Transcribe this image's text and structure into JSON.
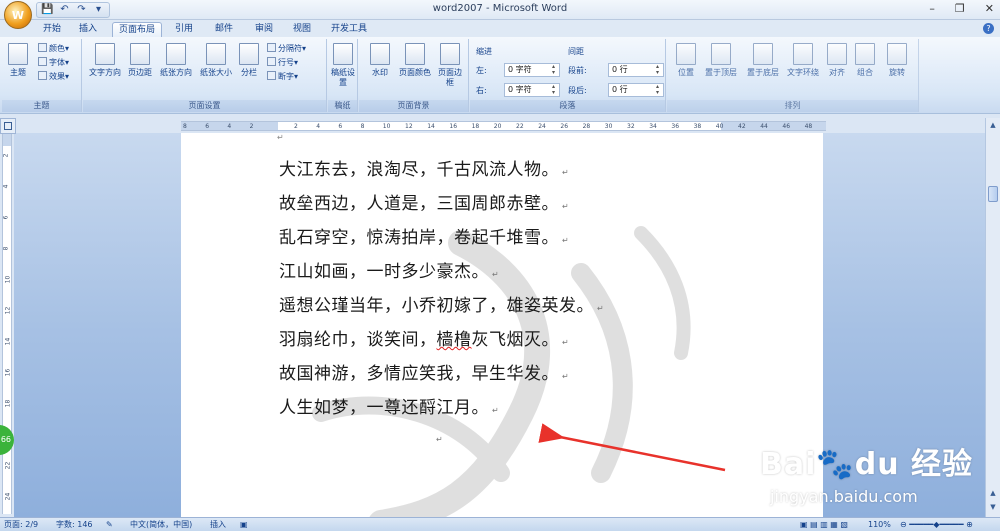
{
  "window": {
    "title": "word2007 - Microsoft Word",
    "minimize": "–",
    "restore": "❐",
    "close": "✕"
  },
  "office_button": {
    "label": "W"
  },
  "qat": {
    "save": "💾",
    "undo": "↶",
    "redo": "↷",
    "customize": "▾"
  },
  "tabs": [
    "开始",
    "插入",
    "页面布局",
    "引用",
    "邮件",
    "审阅",
    "视图",
    "开发工具"
  ],
  "active_tab": "页面布局",
  "ribbon": {
    "theme_group": {
      "label": "主题",
      "theme": "主题",
      "colors": "颜色",
      "fonts": "字体",
      "effects": "效果"
    },
    "page_setup_group": {
      "label": "页面设置",
      "text_direction": "文字方向",
      "margins": "页边距",
      "orientation": "纸张方向",
      "size": "纸张大小",
      "columns": "分栏",
      "breaks": "分隔符",
      "line_numbers": "行号",
      "hyphenation": "断字"
    },
    "draft_group": {
      "label": "稿纸",
      "draft": "稿纸设置"
    },
    "background_group": {
      "label": "页面背景",
      "watermark": "水印",
      "page_color": "页面颜色",
      "page_borders": "页面边框"
    },
    "paragraph_group": {
      "label": "段落",
      "indent": "缩进",
      "spacing": "间距",
      "left_label": "左:",
      "right_label": "右:",
      "before_label": "段前:",
      "after_label": "段后:",
      "left_value": "0 字符",
      "right_value": "0 字符",
      "before_value": "0 行",
      "after_value": "0 行"
    },
    "arrange_group": {
      "label": "排列",
      "position": "位置",
      "bring_front": "置于顶层",
      "send_back": "置于底层",
      "wrap": "文字环绕",
      "align": "对齐",
      "group": "组合",
      "rotate": "旋转"
    }
  },
  "ruler": {
    "ticks": [
      "8",
      "6",
      "4",
      "2",
      "",
      "2",
      "4",
      "6",
      "8",
      "10",
      "12",
      "14",
      "16",
      "18",
      "20",
      "22",
      "24",
      "26",
      "28",
      "30",
      "32",
      "34",
      "36",
      "38",
      "40",
      "42",
      "44",
      "46",
      "48"
    ]
  },
  "vruler": {
    "ticks": [
      "2",
      "4",
      "6",
      "8",
      "10",
      "12",
      "14",
      "16",
      "18",
      "20",
      "22",
      "24"
    ]
  },
  "document": {
    "lines": [
      "大江东去，浪淘尽，千古风流人物。",
      "故垒西边，人道是，三国周郎赤壁。",
      "乱石穿空，惊涛拍岸，卷起千堆雪。",
      "江山如画，一时多少豪杰。",
      "遥想公瑾当年，小乔初嫁了，雄姿英发。",
      "羽扇纶巾，谈笑间，樯橹灰飞烟灭。",
      "故国神游，多情应笑我，早生华发。",
      "人生如梦，一尊还酹江月。"
    ],
    "squiggle_word": "樯橹",
    "para_mark": "↵"
  },
  "status": {
    "page": "页面: 2/9",
    "words": "字数: 146",
    "language": "中文(简体，中国)",
    "mode": "插入",
    "zoom": "110%"
  },
  "badge": {
    "green": "66"
  },
  "watermark_brand": {
    "brand": "Bai🐾du 经验",
    "url": "jingyan.baidu.com"
  },
  "colors": {
    "accent": "#15428b",
    "arrow": "#e8322b",
    "ribbon": "#dbe6f4"
  }
}
